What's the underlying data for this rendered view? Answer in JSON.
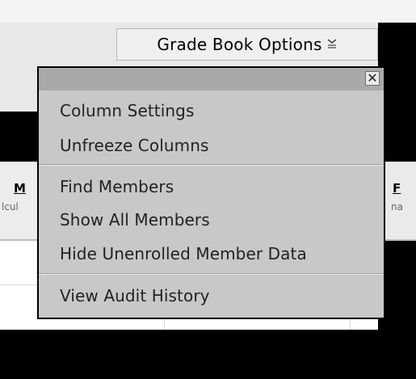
{
  "toolbar": {
    "grade_book_options_label": "Grade Book Options",
    "grade_book_options_icon": "menu-chevron-icon"
  },
  "grid": {
    "columns": [
      {
        "header": "M",
        "sub": "lcul"
      },
      {
        "header": "F",
        "sub": "na"
      }
    ]
  },
  "menu": {
    "close_label": "✕",
    "items": [
      "Column Settings",
      "Unfreeze Columns",
      "Find Members",
      "Show All Members",
      "Hide Unenrolled Member Data",
      "View Audit History"
    ]
  },
  "colors": {
    "menu_background": "#c8c8c8",
    "menu_titlebar": "#a9a9a9",
    "menu_border": "#000000"
  }
}
